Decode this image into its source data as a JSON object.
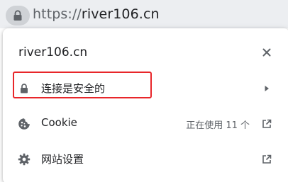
{
  "address_bar": {
    "url_scheme": "https://",
    "url_host": "river106.cn"
  },
  "popup": {
    "title": "river106.cn",
    "close_icon": "close-icon",
    "rows": [
      {
        "id": "connection",
        "icon": "lock-icon",
        "label": "连接是安全的",
        "trail_icon": "chevron-right-icon"
      },
      {
        "id": "cookie",
        "icon": "cookie-icon",
        "label": "Cookie",
        "status": "正在使用 11 个",
        "trail_icon": "open-in-new-icon"
      },
      {
        "id": "site-settings",
        "icon": "gear-icon",
        "label": "网站设置",
        "trail_icon": "open-in-new-icon"
      }
    ]
  },
  "annotation": {
    "highlight_color": "#e8262a"
  },
  "colors": {
    "icon": "#5f6368",
    "text": "#202124",
    "omnibox_bg": "#eceef1"
  }
}
